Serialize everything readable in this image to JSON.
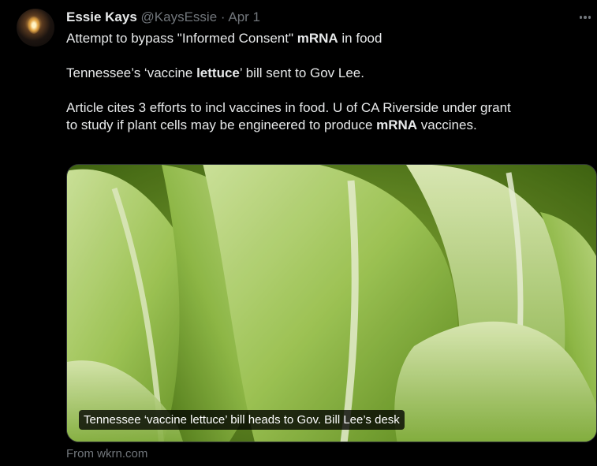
{
  "tweet": {
    "author_name": "Essie Kays",
    "author_handle": "@KaysEssie",
    "separator": "·",
    "date": "Apr 1",
    "lines": [
      [
        {
          "t": "Attempt to bypass \"Informed Consent\" "
        },
        {
          "t": "mRNA",
          "b": true
        },
        {
          "t": " in food"
        }
      ],
      [],
      [
        {
          "t": "Tennessee’s ‘vaccine "
        },
        {
          "t": "lettuce",
          "b": true
        },
        {
          "t": "’ bill sent to Gov Lee."
        }
      ],
      [],
      [
        {
          "t": "Article cites 3 efforts to incl vaccines in food. U of CA Riverside under grant"
        }
      ],
      [
        {
          "t": "to study if plant cells may be engineered to produce "
        },
        {
          "t": "mRNA",
          "b": true
        },
        {
          "t": " vaccines."
        }
      ]
    ],
    "more_icon": "more-horizontal-icon"
  },
  "media": {
    "image_subject": "romaine lettuce heads",
    "caption": "Tennessee ‘vaccine lettuce’ bill heads to Gov. Bill Lee’s desk",
    "source": "From wkrn.com"
  },
  "colors": {
    "background": "#000000",
    "text_primary": "#e7e9ea",
    "text_secondary": "#71767b",
    "lettuce_light": "#d4eca0",
    "lettuce_dark": "#4f7a16"
  }
}
